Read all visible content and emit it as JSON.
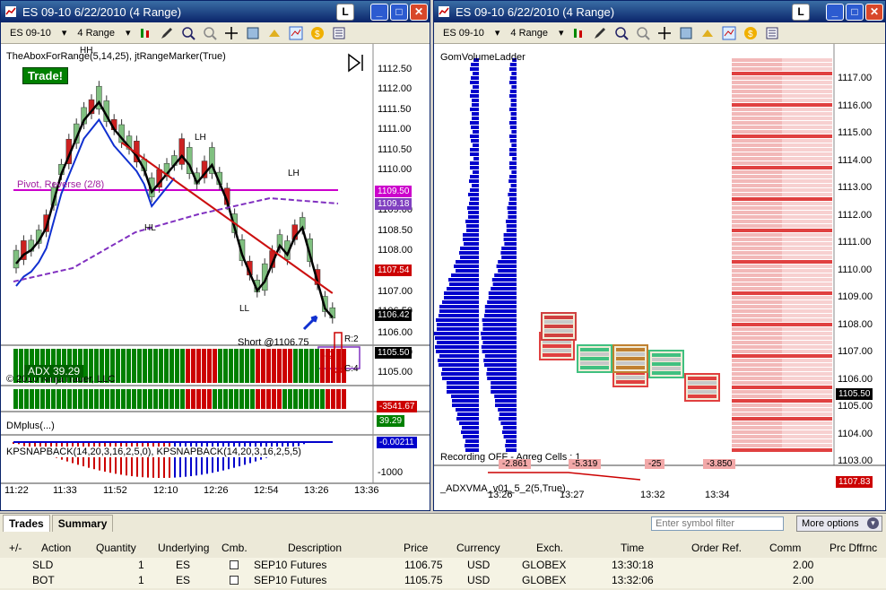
{
  "left_window": {
    "title": "ES 09-10  6/22/2010 (4 Range)",
    "toolbar": {
      "instrument": "ES 09-10",
      "interval": "4 Range"
    },
    "indicator_label": "TheAboxForRange(5,14,25), jtRangeMarker(True)",
    "trade_badge": "Trade!",
    "pivot_label": "Pivot, Reverse (2/8)",
    "price_ticks": [
      "1112.50",
      "1112.00",
      "1111.50",
      "1111.00",
      "1110.50",
      "1110.00",
      "1109.00",
      "1108.50",
      "1108.00",
      "1107.00",
      "1106.50",
      "1106.00",
      "1105.50",
      "1105.00"
    ],
    "price_tags": [
      {
        "text": "1109.50",
        "color": "#cc00cc"
      },
      {
        "text": "1109.18",
        "color": "#8040c0"
      },
      {
        "text": "1107.54",
        "color": "#cc0000"
      },
      {
        "text": "1106.42",
        "color": "#000000"
      },
      {
        "text": "1105.50",
        "color": "#000000"
      }
    ],
    "swing_labels": [
      "HH",
      "LH",
      "HL",
      "LH",
      "LL"
    ],
    "short_label": "Short @1106.75",
    "range_counter": "-2",
    "range_labels": [
      "R:2",
      "C:4"
    ],
    "copyright": "© 2010 NinjaTrader, LLC",
    "adx_label": "ADX 39.29",
    "dm_label": "DMplus(...)",
    "dm_values": [
      {
        "text": "-3541.67",
        "color": "#cc0000"
      },
      {
        "text": "39.29",
        "color": "#008000"
      },
      {
        "text": "-0.00211",
        "color": "#0000cc"
      }
    ],
    "bottom_tick": "-1000",
    "knap_label": "KPSNAPBACK(14,20,3,16,2,5,0), KPSNAPBACK(14,20,3,16,2,5,5)",
    "time_ticks": [
      "11:22",
      "11:33",
      "11:52",
      "12:10",
      "12:26",
      "12:54",
      "13:26",
      "13:36"
    ]
  },
  "right_window": {
    "title": "ES 09-10  6/22/2010 (4 Range)",
    "toolbar": {
      "instrument": "ES 09-10",
      "interval": "4 Range"
    },
    "indicator_label": "GomVolumeLadder",
    "price_ticks": [
      "1117.00",
      "1116.00",
      "1115.00",
      "1114.00",
      "1113.00",
      "1112.00",
      "1111.00",
      "1110.00",
      "1109.00",
      "1108.00",
      "1107.00",
      "1106.00",
      "1105.00",
      "1104.00",
      "1103.00"
    ],
    "price_tag": {
      "text": "1105.50",
      "color": "#000000"
    },
    "bottom_tag": {
      "text": "1107.83",
      "color": "#cc0000"
    },
    "recording_label": "Recording OFF - Agreg Cells : 1",
    "delta_boxes": [
      "-2.861",
      "-5.319",
      "-25",
      "-3.850"
    ],
    "adx_label": "_ADXVMA_v01_5_2(5,True)",
    "time_ticks": [
      "13:26",
      "13:27",
      "13:32",
      "13:34"
    ]
  },
  "bottom_panel": {
    "tabs": [
      "Trades",
      "Summary"
    ],
    "filter_placeholder": "Enter symbol filter",
    "more_options": "More options",
    "columns": [
      "+/-",
      "Action",
      "Quantity",
      "Underlying",
      "Cmb.",
      "Description",
      "Price",
      "Currency",
      "Exch.",
      "Time",
      "Order Ref.",
      "Comm",
      "Prc Dffrnc"
    ],
    "rows": [
      {
        "action": "SLD",
        "quantity": "1",
        "underlying": "ES",
        "description": "SEP10 Futures",
        "price": "1106.75",
        "currency": "USD",
        "exch": "GLOBEX",
        "time": "13:30:18",
        "comm": "2.00"
      },
      {
        "action": "BOT",
        "quantity": "1",
        "underlying": "ES",
        "description": "SEP10 Futures",
        "price": "1105.75",
        "currency": "USD",
        "exch": "GLOBEX",
        "time": "13:32:06",
        "comm": "2.00"
      }
    ]
  },
  "colors": {
    "bull": "#008000",
    "bear": "#cc0000",
    "ladder": "#0000cc",
    "pivot": "#cc00cc"
  }
}
